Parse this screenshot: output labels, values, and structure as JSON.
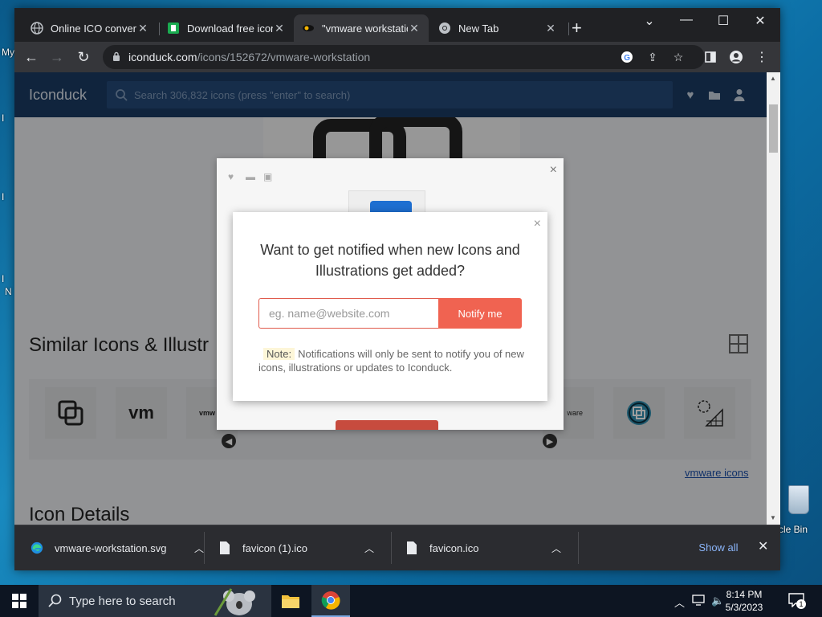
{
  "desktop": {
    "left_labels": [
      "My",
      "I",
      "I",
      "I",
      "N"
    ],
    "recycle_bin_label": "cle Bin"
  },
  "browser": {
    "tabs": [
      {
        "title": "Online ICO converte",
        "icon": "globe-icon"
      },
      {
        "title": "Download free icon",
        "icon": "iconduck-green-icon"
      },
      {
        "title": "\"vmware workstatio",
        "icon": "vmware-favicon",
        "active": true
      },
      {
        "title": "New Tab",
        "icon": "chrome-icon"
      }
    ],
    "url_domain": "iconduck.com",
    "url_path": "/icons/152672/vmware-workstation"
  },
  "site": {
    "logo": "Iconduck",
    "search_placeholder": "Search 306,832 icons (press \"enter\" to search)",
    "similar_title": "Similar Icons & Illustr",
    "icon_details_title": "Icon Details",
    "more_link": "vmware icons",
    "thumb_vm_label": "vm",
    "thumb_vmware_label": "vmw",
    "thumb_vmware_right_label": "ware"
  },
  "dialog": {
    "heading": "Want to get notified when new Icons and Illustrations get added?",
    "email_placeholder": "eg. name@website.com",
    "button": "Notify me",
    "note_label": "Note:",
    "note_text": "Notifications will only be sent to notify you of new icons, illustrations or updates to Iconduck.",
    "close": "×"
  },
  "downloads": [
    {
      "name": "vmware-workstation.svg",
      "icon": "edge-icon"
    },
    {
      "name": "favicon (1).ico",
      "icon": "file-icon"
    },
    {
      "name": "favicon.ico",
      "icon": "file-icon"
    }
  ],
  "shelf": {
    "show_all": "Show all"
  },
  "taskbar": {
    "search_placeholder": "Type here to search",
    "time": "8:14 PM",
    "date": "5/3/2023",
    "notification_count": "1"
  },
  "colors": {
    "site_header": "#1b3a63",
    "notify_button": "#f06351",
    "chrome_dark": "#202124"
  }
}
